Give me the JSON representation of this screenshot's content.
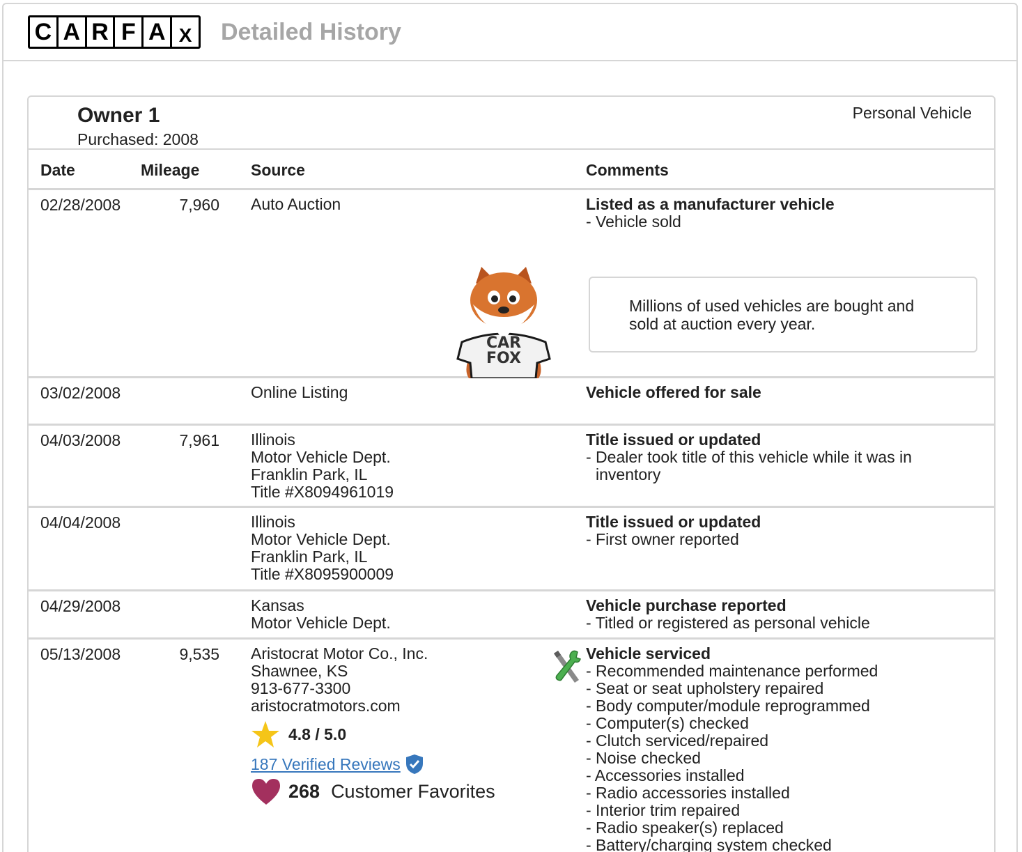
{
  "header": {
    "logo_letters": [
      "C",
      "A",
      "R",
      "F",
      "A",
      "X"
    ],
    "title": "Detailed History"
  },
  "owner": {
    "title": "Owner 1",
    "purchased": "Purchased: 2008",
    "vehicle_type": "Personal Vehicle"
  },
  "columns": {
    "date": "Date",
    "mileage": "Mileage",
    "source": "Source",
    "comments": "Comments"
  },
  "tip": {
    "text": "Millions of used vehicles are bought and sold at auction every year.",
    "mascot_shirt_line1": "CAR",
    "mascot_shirt_line2": "FOX"
  },
  "records": [
    {
      "date": "02/28/2008",
      "mileage": "7,960",
      "source": [
        "Auto Auction"
      ],
      "headline": "Listed as a manufacturer vehicle",
      "items": [
        "- Vehicle sold"
      ]
    },
    {
      "date": "03/02/2008",
      "mileage": "",
      "source": [
        "Online Listing"
      ],
      "headline": "Vehicle offered for sale",
      "items": []
    },
    {
      "date": "04/03/2008",
      "mileage": "7,961",
      "source": [
        "Illinois",
        "Motor Vehicle Dept.",
        "Franklin Park, IL",
        "Title #X8094961019"
      ],
      "headline": "Title issued or updated",
      "items": [
        "- Dealer took title of this vehicle while it was in inventory"
      ]
    },
    {
      "date": "04/04/2008",
      "mileage": "",
      "source": [
        "Illinois",
        "Motor Vehicle Dept.",
        "Franklin Park, IL",
        "Title #X8095900009"
      ],
      "headline": "Title issued or updated",
      "items": [
        "- First owner reported"
      ]
    },
    {
      "date": "04/29/2008",
      "mileage": "",
      "source": [
        "Kansas",
        "Motor Vehicle Dept."
      ],
      "headline": "Vehicle purchase reported",
      "items": [
        "- Titled or registered as personal vehicle"
      ]
    },
    {
      "date": "05/13/2008",
      "mileage": "9,535",
      "source": [
        "Aristocrat Motor Co., Inc.",
        "Shawnee, KS",
        "913-677-3300",
        "aristocratmotors.com"
      ],
      "rating": "4.8 / 5.0",
      "reviews_link": "187 Verified Reviews",
      "favorites_count": "268",
      "favorites_label": "Customer Favorites",
      "headline": "Vehicle serviced",
      "items": [
        "- Recommended maintenance performed",
        "- Seat or seat upholstery repaired",
        "- Body computer/module reprogrammed",
        "- Computer(s) checked",
        "- Clutch serviced/repaired",
        "- Noise checked",
        "- Accessories installed",
        "- Radio accessories installed",
        "- Interior trim repaired",
        "- Radio speaker(s) replaced",
        "- Battery/charging system checked"
      ]
    }
  ],
  "colors": {
    "border": "#d6d6d6",
    "link": "#3777bc",
    "star": "#f5c518",
    "heart": "#a3305e",
    "header_title": "#a6a6a6"
  }
}
